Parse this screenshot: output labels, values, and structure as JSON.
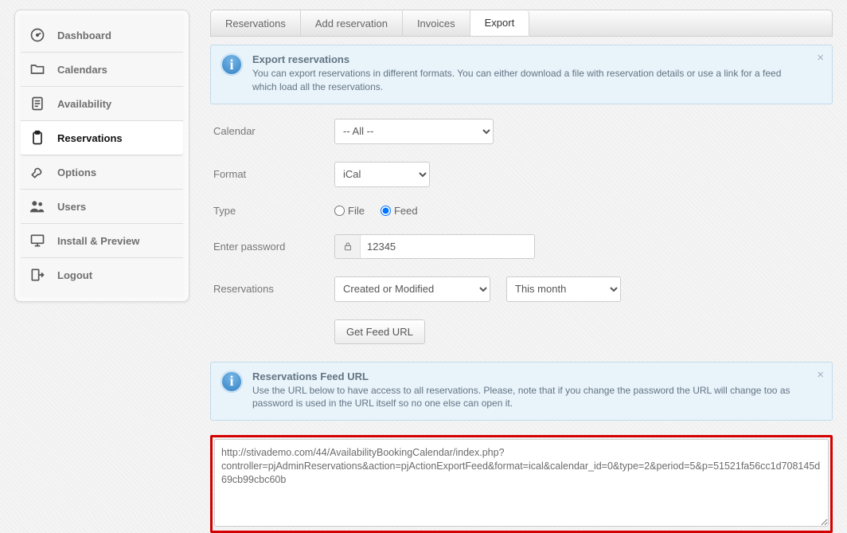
{
  "sidebar": {
    "items": [
      {
        "label": "Dashboard"
      },
      {
        "label": "Calendars"
      },
      {
        "label": "Availability"
      },
      {
        "label": "Reservations"
      },
      {
        "label": "Options"
      },
      {
        "label": "Users"
      },
      {
        "label": "Install & Preview"
      },
      {
        "label": "Logout"
      }
    ],
    "active_index": 3
  },
  "tabs": {
    "items": [
      "Reservations",
      "Add reservation",
      "Invoices",
      "Export"
    ],
    "active_index": 3
  },
  "info1": {
    "title": "Export reservations",
    "body": "You can export reservations in different formats. You can either download a file with reservation details or use a link for a feed which load all the reservations."
  },
  "form": {
    "calendar_label": "Calendar",
    "calendar_value": "-- All --",
    "format_label": "Format",
    "format_value": "iCal",
    "type_label": "Type",
    "type_option_file": "File",
    "type_option_feed": "Feed",
    "type_selected": "Feed",
    "password_label": "Enter password",
    "password_value": "12345",
    "reservations_label": "Reservations",
    "reservations_criteria_value": "Created or Modified",
    "reservations_period_value": "This month",
    "get_feed_button": "Get Feed URL"
  },
  "info2": {
    "title": "Reservations Feed URL",
    "body": "Use the URL below to have access to all reservations. Please, note that if you change the password the URL will change too as password is used in the URL itself so no one else can open it."
  },
  "feed_url": "http://stivademo.com/44/AvailabilityBookingCalendar/index.php?controller=pjAdminReservations&action=pjActionExportFeed&format=ical&calendar_id=0&type=2&period=5&p=51521fa56cc1d708145d69cb99cbc60b"
}
